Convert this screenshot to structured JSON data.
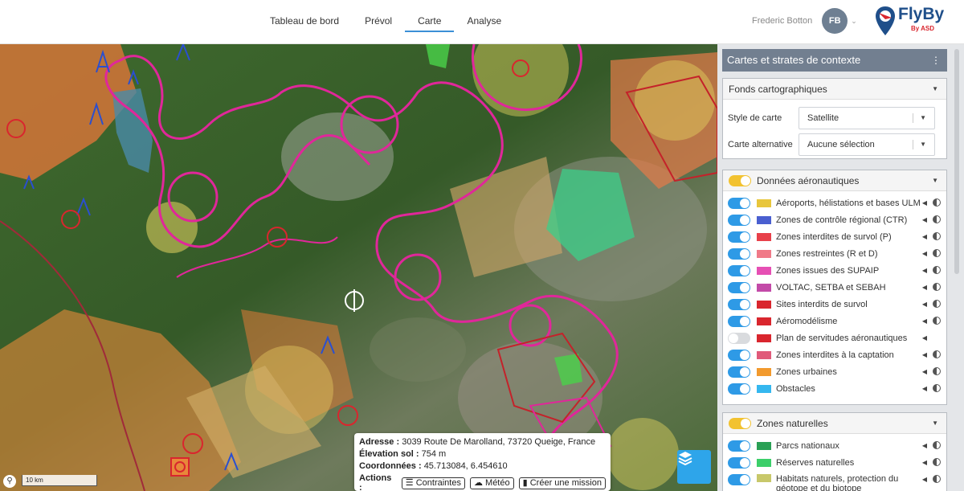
{
  "nav": {
    "items": [
      "Tableau de bord",
      "Prévol",
      "Carte",
      "Analyse"
    ],
    "active_index": 2
  },
  "user": {
    "name": "Frederic Botton",
    "initials": "FB"
  },
  "logo": {
    "name": "FlyBy",
    "by": "By ASD"
  },
  "map": {
    "scale_label": "10 km",
    "popup": {
      "address_label": "Adresse :",
      "address": "3039 Route De Marolland, 73720 Queige, France",
      "elevation_label": "Élevation sol :",
      "elevation": "754 m",
      "coords_label": "Coordonnées :",
      "coords": "45.713084, 6.454610",
      "actions_label": "Actions :",
      "actions": [
        "Contraintes",
        "Météo",
        "Créer une mission"
      ]
    }
  },
  "panel": {
    "title": "Cartes et strates de contexte",
    "basemaps": {
      "title": "Fonds cartographiques",
      "style_label": "Style de carte",
      "style_value": "Satellite",
      "alt_label": "Carte alternative",
      "alt_value": "Aucune sélection"
    },
    "aero": {
      "title": "Données aéronautiques",
      "layers": [
        {
          "label": "Aéroports, hélistations et bases ULM",
          "on": true,
          "color": "#e8c63c"
        },
        {
          "label": "Zones de contrôle régional (CTR)",
          "on": true,
          "color": "#4a5fd0"
        },
        {
          "label": "Zones interdites de survol (P)",
          "on": true,
          "color": "#e8404a"
        },
        {
          "label": "Zones restreintes (R et D)",
          "on": true,
          "color": "#f07a88"
        },
        {
          "label": "Zones issues des SUPAIP",
          "on": true,
          "color": "#e64fb4"
        },
        {
          "label": "VOLTAC, SETBA et SEBAH",
          "on": true,
          "color": "#c34aa8"
        },
        {
          "label": "Sites interdits de survol",
          "on": true,
          "color": "#d9262e"
        },
        {
          "label": "Aéromodélisme",
          "on": true,
          "color": "#d9262e"
        },
        {
          "label": "Plan de servitudes aéronautiques",
          "on": false,
          "color": "#d9262e"
        },
        {
          "label": "Zones interdites à la captation",
          "on": true,
          "color": "#e05a7a"
        },
        {
          "label": "Zones urbaines",
          "on": true,
          "color": "#f29a2e"
        },
        {
          "label": "Obstacles",
          "on": true,
          "color": "#35b7ef"
        }
      ]
    },
    "nature": {
      "title": "Zones naturelles",
      "layers": [
        {
          "label": "Parcs nationaux",
          "on": true,
          "color": "#2aa055"
        },
        {
          "label": "Réserves naturelles",
          "on": true,
          "color": "#3ccf6a"
        },
        {
          "label": "Habitats naturels, protection du géotope et du biotope",
          "on": true,
          "color": "#c8c86a"
        }
      ]
    }
  }
}
